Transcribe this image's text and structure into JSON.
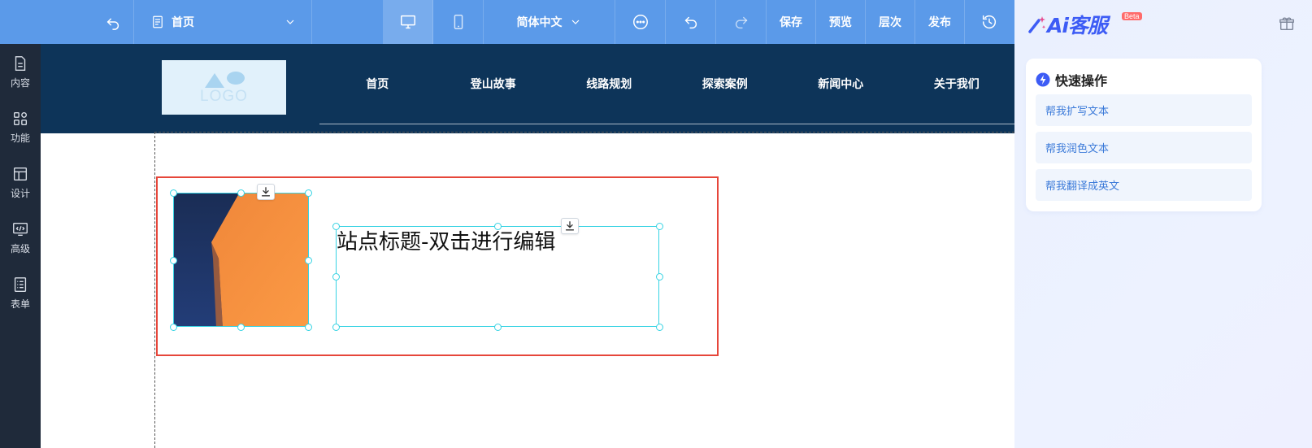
{
  "toolbar": {
    "page_selector": "首页",
    "language": "简体中文",
    "save_label": "保存",
    "preview_label": "预览",
    "layers_label": "层次",
    "publish_label": "发布"
  },
  "sidebar": {
    "items": [
      {
        "label": "内容",
        "icon": "document-icon"
      },
      {
        "label": "功能",
        "icon": "grid-icon"
      },
      {
        "label": "设计",
        "icon": "layout-icon"
      },
      {
        "label": "高级",
        "icon": "code-monitor-icon"
      },
      {
        "label": "表单",
        "icon": "form-list-icon"
      }
    ]
  },
  "site": {
    "logo_text": "LOGO",
    "nav": [
      "首页",
      "登山故事",
      "线路规划",
      "探索案例",
      "新闻中心",
      "关于我们"
    ]
  },
  "canvas": {
    "title_text": "站点标题-双击进行编辑"
  },
  "ai": {
    "title": "Ai客服",
    "beta": "Beta",
    "quick_title": "快速操作",
    "quick_items": [
      "帮我扩写文本",
      "帮我润色文本",
      "帮我翻译成英文"
    ]
  },
  "colors": {
    "toolbar": "#5b9ae9",
    "sidebar": "#1f2a3a",
    "site_header": "#0d3459",
    "selection": "#e6463a",
    "element_outline": "#36d3e3",
    "ai_accent": "#3d5cf5"
  }
}
